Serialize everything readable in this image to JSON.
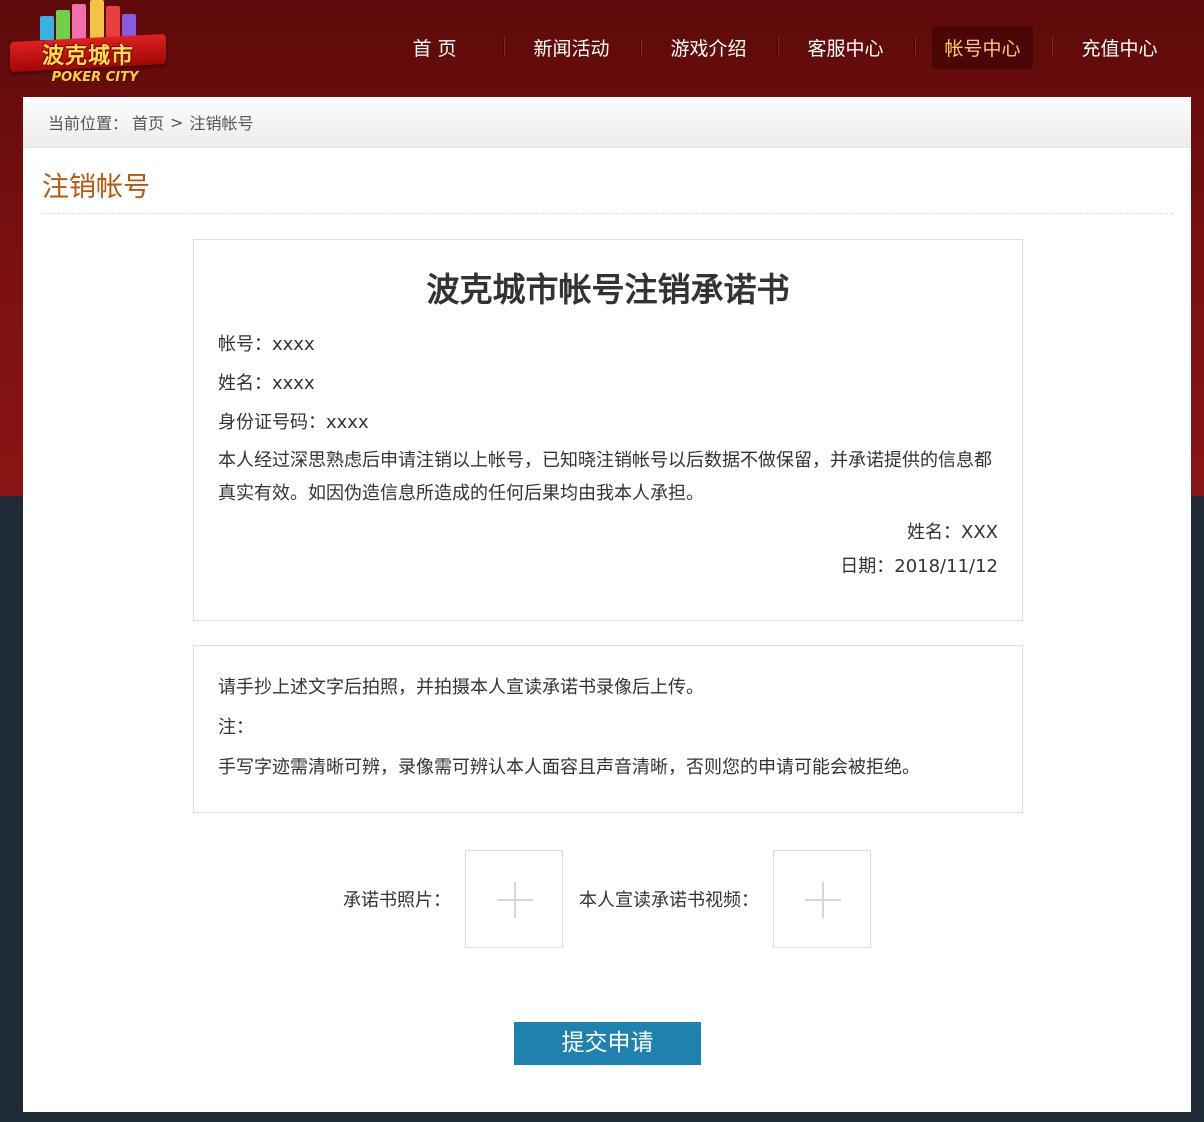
{
  "brand": {
    "logo_cn": "波克城市",
    "logo_en": "POKER CITY",
    "accent": "#b35a10",
    "primary_button": "#1f82ae",
    "header_bg": "#6d0e0e",
    "footer_bg": "#1e2a35"
  },
  "nav": {
    "items": [
      {
        "label": "首 页"
      },
      {
        "label": "新闻活动"
      },
      {
        "label": "游戏介绍"
      },
      {
        "label": "客服中心"
      },
      {
        "label": "帐号中心",
        "active": true
      },
      {
        "label": "充值中心"
      }
    ]
  },
  "breadcrumb": {
    "prefix": "当前位置：",
    "home": "首页",
    "separator": ">",
    "current": "注销帐号"
  },
  "page": {
    "title": "注销帐号"
  },
  "pledge": {
    "heading": "波克城市帐号注销承诺书",
    "account": "帐号：xxxx",
    "name": "姓名：xxxx",
    "id_number": "身份证号码：xxxx",
    "body": "本人经过深思熟虑后申请注销以上帐号，已知晓注销帐号以后数据不做保留，并承诺提供的信息都真实有效。如因伪造信息所造成的任何后果均由我本人承担。",
    "signature_name": "姓名：XXX",
    "signature_date": "日期：2018/11/12"
  },
  "notice": {
    "line1": "请手抄上述文字后拍照，并拍摄本人宣读承诺书录像后上传。",
    "line2": "注：",
    "line3": "手写字迹需清晰可辨，录像需可辨认本人面容且声音清晰，否则您的申请可能会被拒绝。"
  },
  "uploads": {
    "photo_label": "承诺书照片：",
    "video_label": "本人宣读承诺书视频：",
    "add_icon": "plus-icon"
  },
  "submit": {
    "label": "提交申请"
  }
}
